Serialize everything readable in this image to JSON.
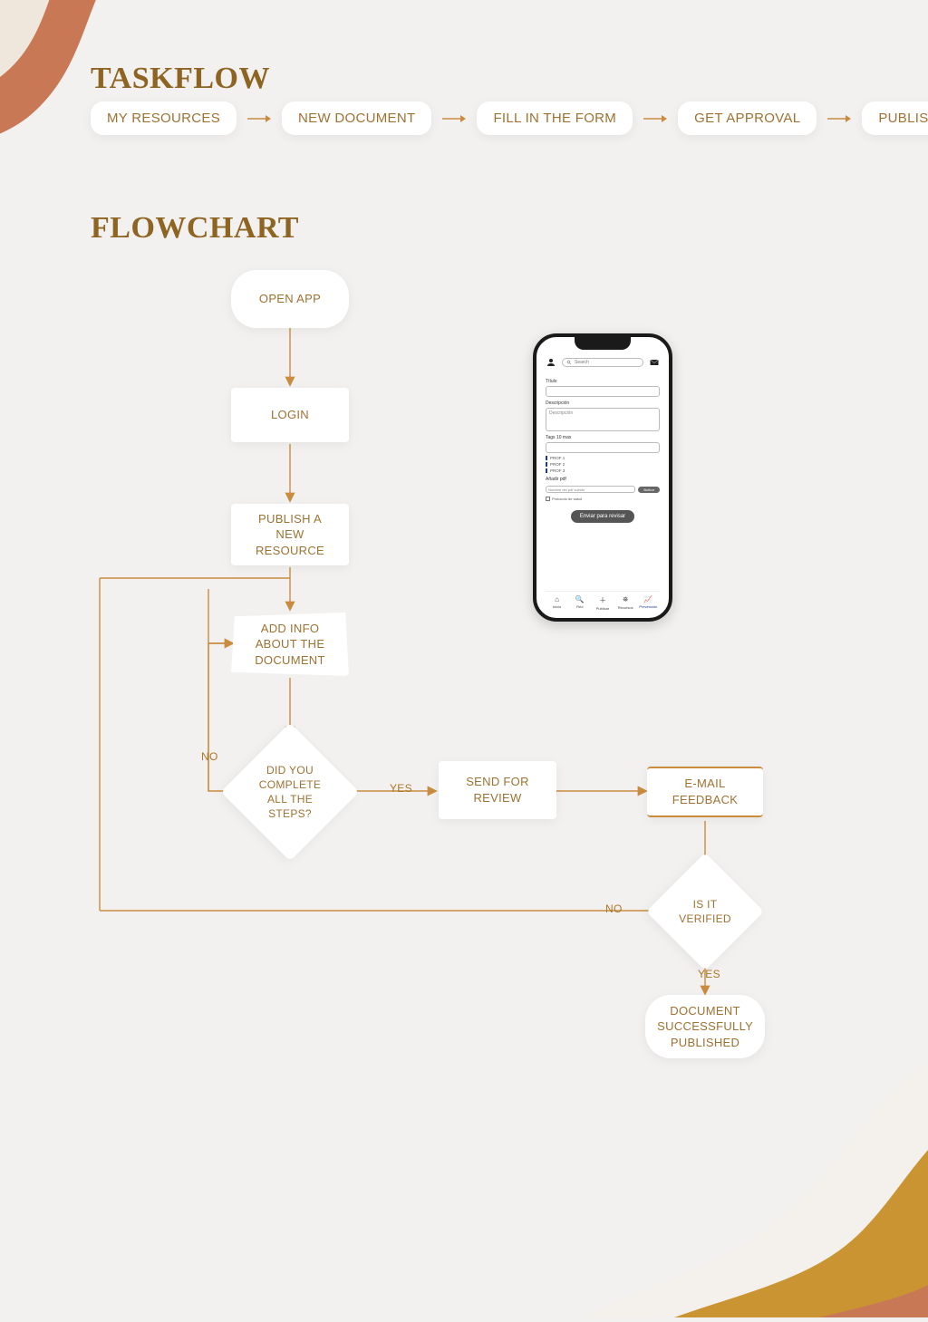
{
  "titles": {
    "taskflow": "TASKFLOW",
    "flowchart": "FLOWCHART"
  },
  "pills": [
    "MY RESOURCES",
    "NEW DOCUMENT",
    "FILL IN THE FORM",
    "GET APPROVAL",
    "PUBLISH"
  ],
  "nodes": {
    "open_app": "OPEN APP",
    "login": "LOGIN",
    "publish_new": "PUBLISH A NEW RESOURCE",
    "add_info": "ADD INFO ABOUT THE DOCUMENT",
    "decision_steps": "DID YOU COMPLETE ALL THE STEPS?",
    "send_review": "SEND FOR REVIEW",
    "email_feedback": "E-MAIL FEEDBACK",
    "decision_verified": "IS IT VERIFIED",
    "final": "DOCUMENT SUCCESSFULLY PUBLISHED"
  },
  "labels": {
    "yes": "YES",
    "no": "NO"
  },
  "phone": {
    "search_placeholder": "Search",
    "title_label": "Título",
    "desc_label": "Descripción",
    "desc_placeholder": "Descripción",
    "tags_label": "Tags 10 max",
    "tag1": "PROF 1",
    "tag2": "PROF 2",
    "tag3": "PROF 3",
    "pdf_label": "Añadir pdf",
    "pdf_placeholder": "Nombre del pdf subido",
    "button": "Button",
    "checkbox": "Protocolo de salud",
    "submit": "Enviar para revisar",
    "nav": {
      "inicio": "Inicio",
      "red": "Red",
      "publicar": "Publicar",
      "recursos": "Recursos",
      "prevencion": "Prevención"
    }
  },
  "colors": {
    "accent_gold": "#a87829",
    "accent_terracotta": "#c97856",
    "line": "#c98c3e",
    "bg": "#f3f1ef"
  },
  "chart_data": {
    "type": "flowchart",
    "title": "FLOWCHART",
    "nodes": [
      {
        "id": "open_app",
        "shape": "rounded",
        "label": "OPEN APP"
      },
      {
        "id": "login",
        "shape": "rect",
        "label": "LOGIN"
      },
      {
        "id": "publish_new",
        "shape": "rect",
        "label": "PUBLISH A NEW RESOURCE"
      },
      {
        "id": "add_info",
        "shape": "trapezoid",
        "label": "ADD INFO ABOUT THE DOCUMENT"
      },
      {
        "id": "decision_steps",
        "shape": "diamond",
        "label": "DID YOU COMPLETE ALL THE STEPS?"
      },
      {
        "id": "send_review",
        "shape": "rect",
        "label": "SEND FOR REVIEW"
      },
      {
        "id": "email_feedback",
        "shape": "rect",
        "label": "E-MAIL FEEDBACK"
      },
      {
        "id": "decision_verified",
        "shape": "diamond",
        "label": "IS IT VERIFIED"
      },
      {
        "id": "final",
        "shape": "rounded",
        "label": "DOCUMENT SUCCESSFULLY PUBLISHED"
      }
    ],
    "edges": [
      {
        "from": "open_app",
        "to": "login"
      },
      {
        "from": "login",
        "to": "publish_new"
      },
      {
        "from": "publish_new",
        "to": "add_info"
      },
      {
        "from": "add_info",
        "to": "decision_steps"
      },
      {
        "from": "decision_steps",
        "to": "send_review",
        "label": "YES"
      },
      {
        "from": "decision_steps",
        "to": "add_info",
        "label": "NO"
      },
      {
        "from": "send_review",
        "to": "email_feedback"
      },
      {
        "from": "email_feedback",
        "to": "decision_verified"
      },
      {
        "from": "decision_verified",
        "to": "final",
        "label": "YES"
      },
      {
        "from": "decision_verified",
        "to": "publish_new",
        "label": "NO"
      }
    ],
    "taskflow_sequence": [
      "MY RESOURCES",
      "NEW DOCUMENT",
      "FILL IN THE FORM",
      "GET APPROVAL",
      "PUBLISH"
    ]
  }
}
